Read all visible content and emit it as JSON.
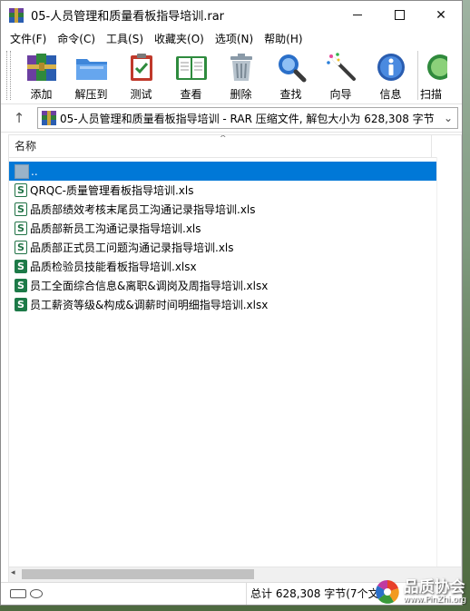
{
  "window": {
    "title": "05-人员管理和质量看板指导培训.rar",
    "min_label": "",
    "max_label": "",
    "close_label": "✕"
  },
  "menu": [
    {
      "label": "文件(F)"
    },
    {
      "label": "命令(C)"
    },
    {
      "label": "工具(S)"
    },
    {
      "label": "收藏夹(O)"
    },
    {
      "label": "选项(N)"
    },
    {
      "label": "帮助(H)"
    }
  ],
  "toolbar": [
    {
      "label": "添加",
      "icon": "books-icon"
    },
    {
      "label": "解压到",
      "icon": "folder-icon"
    },
    {
      "label": "测试",
      "icon": "clipboard-check-icon"
    },
    {
      "label": "查看",
      "icon": "open-book-icon"
    },
    {
      "label": "删除",
      "icon": "trash-icon"
    },
    {
      "label": "查找",
      "icon": "magnifier-icon"
    },
    {
      "label": "向导",
      "icon": "magic-wand-icon"
    },
    {
      "label": "信息",
      "icon": "info-icon"
    },
    {
      "label": "扫描",
      "icon": "scan-icon"
    }
  ],
  "address": {
    "text": "05-人员管理和质量看板指导培训 - RAR 压缩文件, 解包大小为 628,308 字节"
  },
  "list": {
    "column_name": "名称",
    "parent_row": "..",
    "files": [
      {
        "name": "QRQC-质量管理看板指导培训.xls",
        "type": "xls"
      },
      {
        "name": "品质部绩效考核末尾员工沟通记录指导培训.xls",
        "type": "xls"
      },
      {
        "name": "品质部新员工沟通记录指导培训.xls",
        "type": "xls"
      },
      {
        "name": "品质部正式员工问题沟通记录指导培训.xls",
        "type": "xls"
      },
      {
        "name": "品质检验员技能看板指导培训.xlsx",
        "type": "xlsx"
      },
      {
        "name": "员工全面综合信息&离职&调岗及周指导培训.xlsx",
        "type": "xlsx"
      },
      {
        "name": "员工薪资等级&构成&调薪时间明细指导培训.xlsx",
        "type": "xlsx"
      }
    ]
  },
  "status": {
    "text": "总计 628,308 字节(7个文件)"
  },
  "watermark": {
    "main": "品质协会",
    "sub": "www.PinZhi.org"
  }
}
